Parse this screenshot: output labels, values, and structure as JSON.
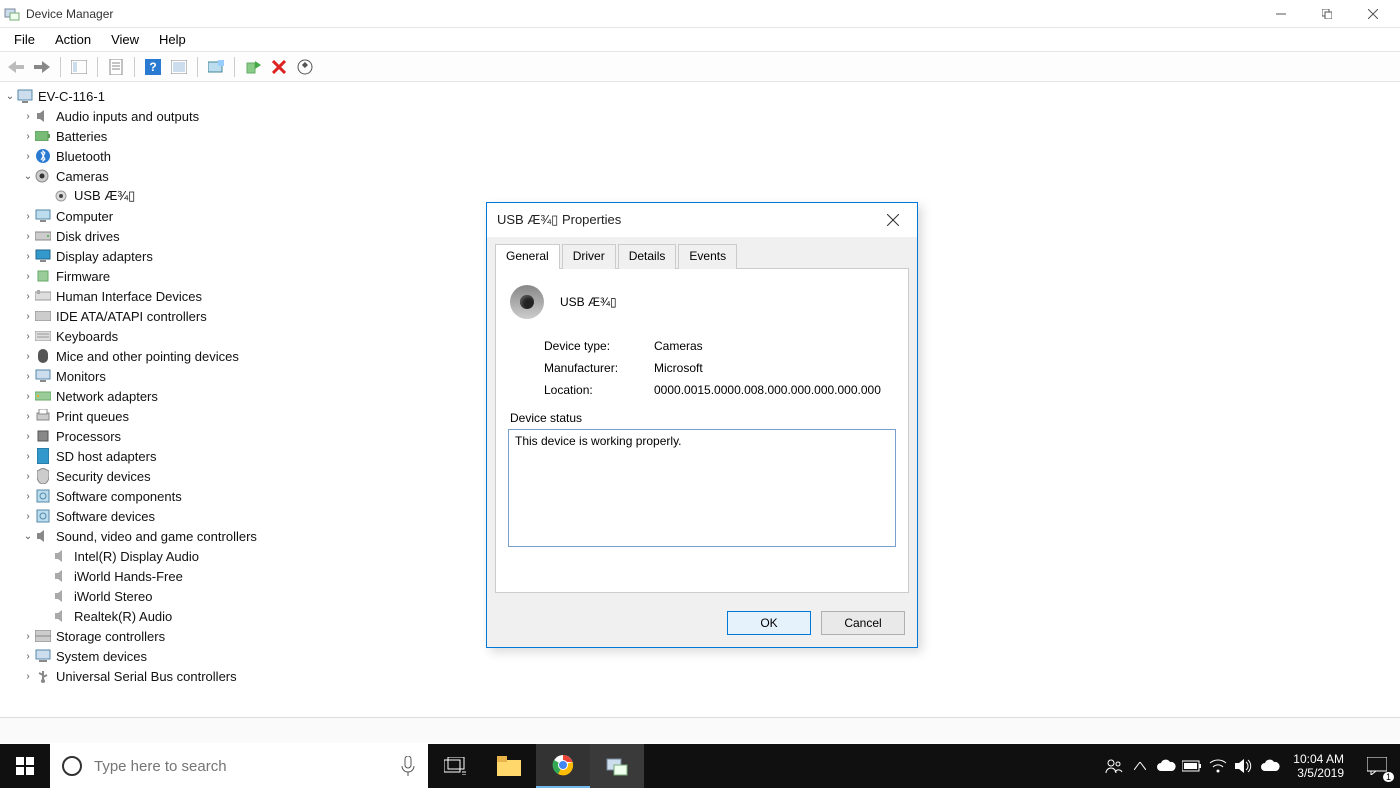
{
  "window": {
    "title": "Device Manager"
  },
  "menu": {
    "file": "File",
    "action": "Action",
    "view": "View",
    "help": "Help"
  },
  "tree": {
    "root": "EV-C-116-1",
    "items": [
      {
        "label": "Audio inputs and outputs",
        "icon": "speaker",
        "expand": "closed"
      },
      {
        "label": "Batteries",
        "icon": "battery",
        "expand": "closed"
      },
      {
        "label": "Bluetooth",
        "icon": "bluetooth",
        "expand": "closed"
      },
      {
        "label": "Cameras",
        "icon": "camera",
        "expand": "open",
        "children": [
          {
            "label": "USB Æ¾▯",
            "icon": "camera-child"
          }
        ]
      },
      {
        "label": "Computer",
        "icon": "computer",
        "expand": "closed"
      },
      {
        "label": "Disk drives",
        "icon": "disk",
        "expand": "closed"
      },
      {
        "label": "Display adapters",
        "icon": "display",
        "expand": "closed"
      },
      {
        "label": "Firmware",
        "icon": "firmware",
        "expand": "closed"
      },
      {
        "label": "Human Interface Devices",
        "icon": "hid",
        "expand": "closed"
      },
      {
        "label": "IDE ATA/ATAPI controllers",
        "icon": "ide",
        "expand": "closed"
      },
      {
        "label": "Keyboards",
        "icon": "keyboard",
        "expand": "closed"
      },
      {
        "label": "Mice and other pointing devices",
        "icon": "mouse",
        "expand": "closed"
      },
      {
        "label": "Monitors",
        "icon": "monitor",
        "expand": "closed"
      },
      {
        "label": "Network adapters",
        "icon": "network",
        "expand": "closed"
      },
      {
        "label": "Print queues",
        "icon": "printer",
        "expand": "closed"
      },
      {
        "label": "Processors",
        "icon": "cpu",
        "expand": "closed"
      },
      {
        "label": "SD host adapters",
        "icon": "sd",
        "expand": "closed"
      },
      {
        "label": "Security devices",
        "icon": "security",
        "expand": "closed"
      },
      {
        "label": "Software components",
        "icon": "software",
        "expand": "closed"
      },
      {
        "label": "Software devices",
        "icon": "software",
        "expand": "closed"
      },
      {
        "label": "Sound, video and game controllers",
        "icon": "speaker",
        "expand": "open",
        "children": [
          {
            "label": "Intel(R) Display Audio",
            "icon": "speaker-child"
          },
          {
            "label": "iWorld Hands-Free",
            "icon": "speaker-child"
          },
          {
            "label": "iWorld Stereo",
            "icon": "speaker-child"
          },
          {
            "label": "Realtek(R) Audio",
            "icon": "speaker-child"
          }
        ]
      },
      {
        "label": "Storage controllers",
        "icon": "storage",
        "expand": "closed"
      },
      {
        "label": "System devices",
        "icon": "system",
        "expand": "closed"
      },
      {
        "label": "Universal Serial Bus controllers",
        "icon": "usb",
        "expand": "closed"
      }
    ]
  },
  "dialog": {
    "title": "USB Æ¾▯ Properties",
    "tabs": {
      "general": "General",
      "driver": "Driver",
      "details": "Details",
      "events": "Events"
    },
    "device_name": "USB Æ¾▯",
    "device_type_label": "Device type:",
    "device_type": "Cameras",
    "manufacturer_label": "Manufacturer:",
    "manufacturer": "Microsoft",
    "location_label": "Location:",
    "location": "0000.0015.0000.008.000.000.000.000.000",
    "status_label": "Device status",
    "status_text": "This device is working properly.",
    "ok": "OK",
    "cancel": "Cancel"
  },
  "taskbar": {
    "search_placeholder": "Type here to search",
    "time": "10:04 AM",
    "date": "3/5/2019",
    "notif_count": "1"
  }
}
